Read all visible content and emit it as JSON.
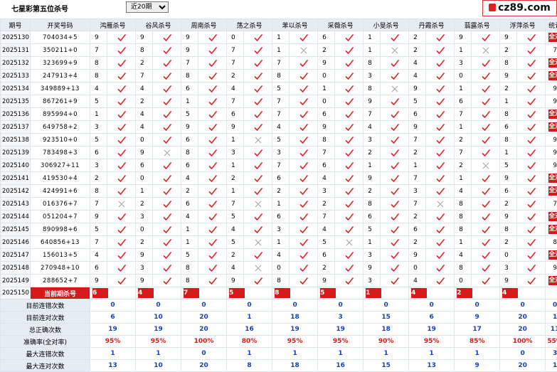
{
  "header": {
    "title": "七星彩第五位杀号",
    "period_select": "近20期",
    "logo": "cz89.com"
  },
  "columns": {
    "issue": "期号",
    "number": "开奖号码",
    "experts": [
      "鸿雁杀号",
      "谷风杀号",
      "周南杀号",
      "荡之杀号",
      "苯以杀号",
      "采薇杀号",
      "小旻杀号",
      "丹霞杀号",
      "蓊露杀号",
      "浮萍杀号"
    ],
    "stat": "统计"
  },
  "rows": [
    {
      "issue": "2025130",
      "num": "704034+5",
      "v": [
        "9",
        "9",
        "9",
        "0",
        "1",
        "6",
        "1",
        "2",
        "9",
        "9"
      ],
      "x": [
        0,
        0,
        0,
        0,
        0,
        0,
        0,
        0,
        0,
        0
      ],
      "stat": "全对"
    },
    {
      "issue": "2025131",
      "num": "350211+0",
      "v": [
        "7",
        "8",
        "9",
        "7",
        "1",
        "2",
        "1",
        "2",
        "1",
        "2"
      ],
      "x": [
        0,
        0,
        0,
        0,
        1,
        0,
        1,
        0,
        1,
        0
      ],
      "stat": "7"
    },
    {
      "issue": "2025132",
      "num": "323699+9",
      "v": [
        "8",
        "2",
        "7",
        "7",
        "7",
        "9",
        "8",
        "4",
        "3",
        "8"
      ],
      "x": [
        0,
        0,
        0,
        0,
        0,
        0,
        0,
        0,
        0,
        0
      ],
      "stat": "全对"
    },
    {
      "issue": "2025133",
      "num": "247913+4",
      "v": [
        "8",
        "7",
        "8",
        "2",
        "8",
        "0",
        "3",
        "4",
        "0",
        "9"
      ],
      "x": [
        0,
        0,
        0,
        0,
        0,
        0,
        0,
        0,
        0,
        0
      ],
      "stat": "全对"
    },
    {
      "issue": "2025134",
      "num": "349889+13",
      "v": [
        "4",
        "4",
        "6",
        "4",
        "5",
        "1",
        "8",
        "9",
        "1",
        "2"
      ],
      "x": [
        0,
        0,
        0,
        0,
        0,
        0,
        1,
        0,
        0,
        0
      ],
      "stat": "9"
    },
    {
      "issue": "2025135",
      "num": "867261+9",
      "v": [
        "5",
        "2",
        "1",
        "7",
        "7",
        "0",
        "9",
        "5",
        "6",
        "1"
      ],
      "x": [
        0,
        0,
        0,
        0,
        0,
        0,
        0,
        0,
        0,
        0
      ],
      "stat": "9"
    },
    {
      "issue": "2025136",
      "num": "895994+0",
      "v": [
        "1",
        "4",
        "5",
        "6",
        "7",
        "6",
        "7",
        "6",
        "7",
        "8"
      ],
      "x": [
        0,
        0,
        0,
        0,
        0,
        0,
        0,
        0,
        0,
        0
      ],
      "stat": "全对"
    },
    {
      "issue": "2025137",
      "num": "649758+2",
      "v": [
        "3",
        "4",
        "9",
        "9",
        "4",
        "9",
        "4",
        "9",
        "1",
        "6"
      ],
      "x": [
        0,
        0,
        0,
        0,
        0,
        0,
        0,
        0,
        0,
        0
      ],
      "stat": "全对"
    },
    {
      "issue": "2025138",
      "num": "923510+0",
      "v": [
        "5",
        "0",
        "6",
        "1",
        "5",
        "8",
        "3",
        "7",
        "2",
        "8"
      ],
      "x": [
        0,
        0,
        0,
        1,
        0,
        0,
        0,
        0,
        0,
        0
      ],
      "stat": "9"
    },
    {
      "issue": "2025139",
      "num": "783498+3",
      "v": [
        "6",
        "9",
        "8",
        "3",
        "3",
        "7",
        "2",
        "2",
        "7",
        "1"
      ],
      "x": [
        0,
        1,
        0,
        0,
        0,
        0,
        0,
        0,
        0,
        0
      ],
      "stat": "9"
    },
    {
      "issue": "2025140",
      "num": "306927+11",
      "v": [
        "3",
        "6",
        "6",
        "1",
        "7",
        "6",
        "1",
        "1",
        "2",
        "5"
      ],
      "x": [
        0,
        0,
        0,
        0,
        0,
        0,
        0,
        0,
        1,
        0
      ],
      "stat": "9"
    },
    {
      "issue": "2025141",
      "num": "419530+4",
      "v": [
        "2",
        "0",
        "4",
        "2",
        "6",
        "4",
        "9",
        "7",
        "1",
        "9"
      ],
      "x": [
        0,
        0,
        0,
        0,
        0,
        0,
        0,
        0,
        0,
        0
      ],
      "stat": "全对"
    },
    {
      "issue": "2025142",
      "num": "424991+6",
      "v": [
        "8",
        "1",
        "2",
        "1",
        "2",
        "3",
        "2",
        "3",
        "4",
        "6"
      ],
      "x": [
        0,
        0,
        0,
        0,
        0,
        0,
        0,
        0,
        0,
        0
      ],
      "stat": "全对"
    },
    {
      "issue": "2025143",
      "num": "016376+7",
      "v": [
        "7",
        "2",
        "6",
        "7",
        "1",
        "2",
        "8",
        "7",
        "8",
        "2"
      ],
      "x": [
        1,
        0,
        0,
        1,
        0,
        0,
        0,
        1,
        0,
        0
      ],
      "stat": "7"
    },
    {
      "issue": "2025144",
      "num": "051204+7",
      "v": [
        "9",
        "3",
        "4",
        "5",
        "6",
        "7",
        "6",
        "2",
        "8",
        "9"
      ],
      "x": [
        0,
        0,
        0,
        0,
        0,
        0,
        0,
        0,
        0,
        0
      ],
      "stat": "全对"
    },
    {
      "issue": "2025145",
      "num": "890998+6",
      "v": [
        "5",
        "0",
        "1",
        "4",
        "3",
        "4",
        "5",
        "6",
        "8",
        "8"
      ],
      "x": [
        0,
        0,
        0,
        0,
        0,
        0,
        0,
        0,
        0,
        0
      ],
      "stat": "全对"
    },
    {
      "issue": "2025146",
      "num": "640856+13",
      "v": [
        "7",
        "2",
        "1",
        "5",
        "1",
        "5",
        "1",
        "2",
        "1",
        "2"
      ],
      "x": [
        0,
        0,
        0,
        1,
        0,
        1,
        0,
        0,
        0,
        0
      ],
      "stat": "8"
    },
    {
      "issue": "2025147",
      "num": "156013+5",
      "v": [
        "4",
        "9",
        "5",
        "2",
        "4",
        "6",
        "3",
        "9",
        "4",
        "0"
      ],
      "x": [
        0,
        0,
        0,
        0,
        0,
        0,
        0,
        0,
        0,
        0
      ],
      "stat": "全对"
    },
    {
      "issue": "2025148",
      "num": "270948+10",
      "v": [
        "6",
        "3",
        "8",
        "4",
        "0",
        "2",
        "9",
        "0",
        "8",
        "3"
      ],
      "x": [
        0,
        0,
        0,
        1,
        0,
        0,
        0,
        0,
        0,
        0
      ],
      "stat": "9"
    },
    {
      "issue": "2025149",
      "num": "288652+7",
      "v": [
        "9",
        "9",
        "8",
        "9",
        "8",
        "9",
        "3",
        "4",
        "0",
        "9"
      ],
      "x": [
        0,
        0,
        0,
        0,
        0,
        0,
        0,
        0,
        0,
        0
      ],
      "stat": "全对"
    }
  ],
  "current": {
    "issue": "2025150",
    "label": "当前期杀号",
    "v": [
      "6",
      "4",
      "7",
      "5",
      "8",
      "5",
      "1",
      "4",
      "2",
      "4"
    ]
  },
  "summary": [
    {
      "label": "目前连错次数",
      "v": [
        "0",
        "0",
        "0",
        "0",
        "0",
        "0",
        "0",
        "0",
        "0",
        "0"
      ],
      "stat": "0",
      "cls": "blue"
    },
    {
      "label": "目前连对次数",
      "v": [
        "6",
        "10",
        "20",
        "1",
        "18",
        "3",
        "15",
        "6",
        "9",
        "20"
      ],
      "stat": "1",
      "cls": "blue"
    },
    {
      "label": "总正确次数",
      "v": [
        "19",
        "19",
        "20",
        "16",
        "19",
        "19",
        "18",
        "19",
        "17",
        "20"
      ],
      "stat": "11",
      "cls": "blue"
    },
    {
      "label": "准确率(全对率)",
      "v": [
        "95%",
        "95%",
        "100%",
        "80%",
        "95%",
        "95%",
        "90%",
        "95%",
        "85%",
        "100%"
      ],
      "stat": "55%",
      "cls": "red"
    },
    {
      "label": "最大连错次数",
      "v": [
        "1",
        "1",
        "0",
        "1",
        "1",
        "1",
        "1",
        "1",
        "1",
        "0"
      ],
      "stat": "3",
      "cls": "blue"
    },
    {
      "label": "最大连对次数",
      "v": [
        "13",
        "10",
        "20",
        "8",
        "18",
        "16",
        "15",
        "13",
        "9",
        "20"
      ],
      "stat": "1",
      "cls": "blue"
    }
  ]
}
